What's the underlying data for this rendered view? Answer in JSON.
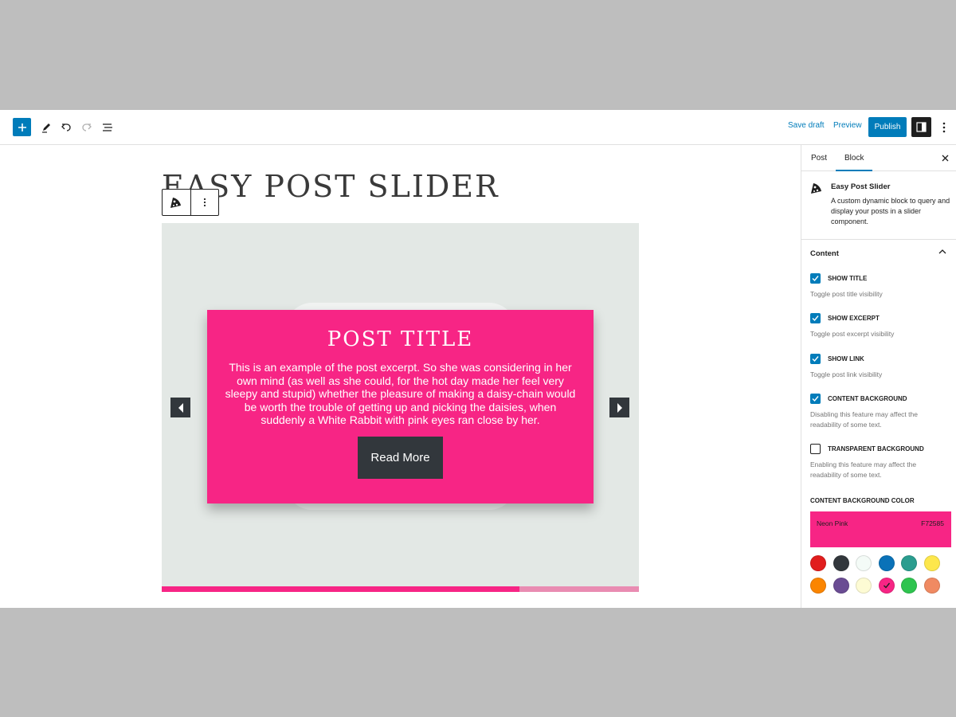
{
  "toolbar": {
    "save_draft": "Save draft",
    "preview": "Preview",
    "publish": "Publish"
  },
  "post": {
    "title": "EASY POST SLIDER"
  },
  "slider": {
    "card_title": "POST TITLE",
    "excerpt": "This is an example of the post excerpt. So she was considering in her own mind (as well as she could, for the hot day made her feel very sleepy and stupid) whether the pleasure of making a daisy-chain would be worth the trouble of getting up and picking the daisies, when suddenly a White Rabbit with pink eyes ran close by her.",
    "read_more": "Read More",
    "progress_fraction": 0.75
  },
  "sidebar": {
    "tabs": [
      {
        "label": "Post",
        "active": false
      },
      {
        "label": "Block",
        "active": true
      }
    ],
    "block": {
      "name": "Easy Post Slider",
      "description": "A custom dynamic block to query and display your posts in a slider component."
    },
    "panel": {
      "title": "Content",
      "options": [
        {
          "label": "SHOW TITLE",
          "help": "Toggle post title visibility",
          "checked": true
        },
        {
          "label": "SHOW EXCERPT",
          "help": "Toggle post excerpt visibility",
          "checked": true
        },
        {
          "label": "SHOW LINK",
          "help": "Toggle post link visibility",
          "checked": true
        },
        {
          "label": "CONTENT BACKGROUND",
          "help": "Disabling this feature may affect the readability of some text.",
          "checked": true
        },
        {
          "label": "TRANSPARENT BACKGROUND",
          "help": "Enabling this feature may affect the readability of some text.",
          "checked": false
        }
      ],
      "color_label": "CONTENT BACKGROUND COLOR",
      "selected_color": {
        "name": "Neon Pink",
        "hex": "F72585"
      },
      "palette": [
        {
          "color": "#e11d1d",
          "selected": false
        },
        {
          "color": "#32373c",
          "selected": false
        },
        {
          "color": "#f4fbf7",
          "selected": false
        },
        {
          "color": "#0a72b8",
          "selected": false
        },
        {
          "color": "#2a9d8f",
          "selected": false
        },
        {
          "color": "#fde74c",
          "selected": false
        },
        {
          "color": "#fb8500",
          "selected": false
        },
        {
          "color": "#6a4c93",
          "selected": false
        },
        {
          "color": "#fdfbd4",
          "selected": false
        },
        {
          "color": "#f72585",
          "selected": true
        },
        {
          "color": "#2ec44f",
          "selected": false
        },
        {
          "color": "#f08a62",
          "selected": false
        }
      ]
    }
  }
}
